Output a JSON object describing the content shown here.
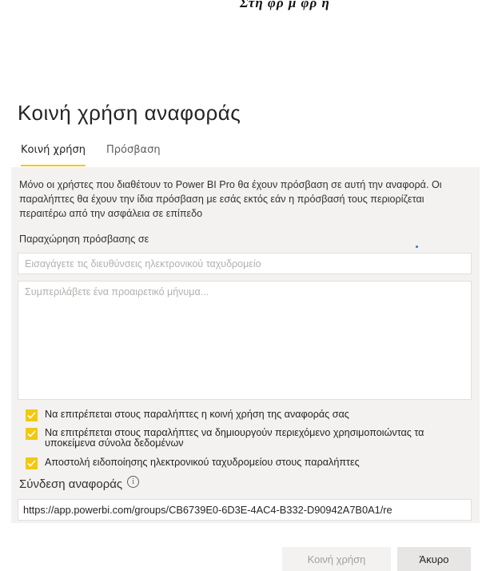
{
  "top_fragment": "Στη  φρ  μ    φρ  η",
  "dialog": {
    "title": "Κοινή χρήση αναφοράς",
    "tabs": [
      {
        "label": "Κοινή χρήση",
        "active": true
      },
      {
        "label": "Πρόσβαση",
        "active": false
      }
    ],
    "info_text": "Μόνο οι χρήστες που διαθέτουν το Power BI Pro θα έχουν πρόσβαση σε αυτή την αναφορά. Οι παραλήπτες θα έχουν την ίδια πρόσβαση με εσάς εκτός εάν η πρόσβασή τους περιορίζεται περαιτέρω από την ασφάλεια σε επίπεδο",
    "grant_access_label": "Παραχώρηση πρόσβασης σε",
    "email_placeholder": "Εισαγάγετε τις διευθύνσεις ηλεκτρονικού ταχυδρομείο",
    "message_placeholder": "Συμπεριλάβετε ένα προαιρετικό μήνυμα...",
    "checkboxes": [
      {
        "label": "Να επιτρέπεται στους παραλήπτες η κοινή χρήση της αναφοράς σας",
        "checked": true
      },
      {
        "label": "Να επιτρέπεται στους παραλήπτες να δημιουργούν περιεχόμενο χρησιμοποιώντας τα υποκείμενα σύνολα δεδομένων",
        "checked": true
      },
      {
        "label": "Αποστολή ειδοποίησης ηλεκτρονικού ταχυδρομείου στους παραλήπτες",
        "checked": true
      }
    ],
    "report_link_label": "Σύνδεση αναφοράς",
    "report_link_value": "https://app.powerbi.com/groups/CB6739E0-6D3E-4AC4-B332-D90942A7B0A1/re",
    "share_button_label": "Κοινή χρήση",
    "cancel_button_label": "Άκυρο"
  },
  "colors": {
    "accent": "#f2c811",
    "panel_bg": "#f3f2f1"
  }
}
